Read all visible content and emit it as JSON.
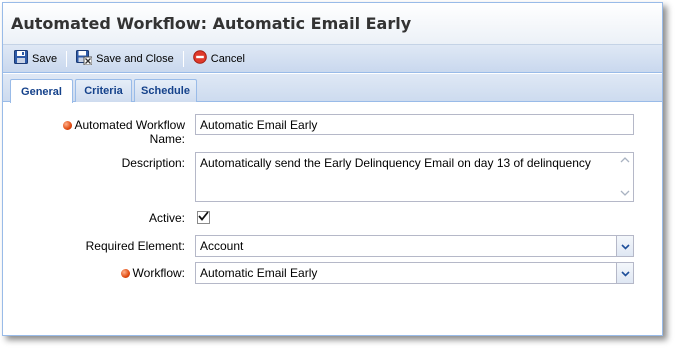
{
  "window": {
    "title": "Automated Workflow: Automatic Email Early"
  },
  "toolbar": {
    "save_label": "Save",
    "save_close_label": "Save and Close",
    "cancel_label": "Cancel"
  },
  "tabs": [
    {
      "label": "General",
      "active": true
    },
    {
      "label": "Criteria",
      "active": false
    },
    {
      "label": "Schedule",
      "active": false
    }
  ],
  "form": {
    "name_label_line1": "Automated Workflow",
    "name_label_line2": "Name:",
    "name_value": "Automatic Email Early",
    "description_label": "Description:",
    "description_value": "Automatically send the Early Delinquency Email on day 13 of delinquency",
    "active_label": "Active:",
    "active_checked": true,
    "required_element_label": "Required Element:",
    "required_element_value": "Account",
    "workflow_label": "Workflow:",
    "workflow_value": "Automatic Email Early"
  },
  "colors": {
    "accent_blue": "#15428b",
    "border_blue": "#99bbe8",
    "required_dot": "#e04a10"
  },
  "icons": [
    "floppy-disk-icon",
    "save-and-close-icon",
    "cancel-icon",
    "required-indicator-icon",
    "chevron-down-icon",
    "checkmark-icon"
  ]
}
